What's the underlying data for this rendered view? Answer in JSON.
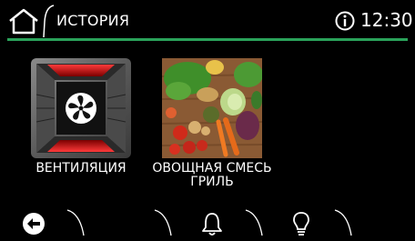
{
  "header": {
    "title": "ИСТОРИЯ",
    "time": "12:30",
    "accent_color": "#2aa35a",
    "icons": [
      "home-icon",
      "info-icon"
    ]
  },
  "history": {
    "items": [
      {
        "label": "ВЕНТИЛЯЦИЯ",
        "icon": "fan-mode-icon"
      },
      {
        "label": "ОВОЩНАЯ СМЕСЬ ГРИЛЬ",
        "icon": "vegetables-photo"
      }
    ]
  },
  "bottom_bar": {
    "icons": [
      "back-icon",
      "bell-icon",
      "lightbulb-icon"
    ]
  }
}
